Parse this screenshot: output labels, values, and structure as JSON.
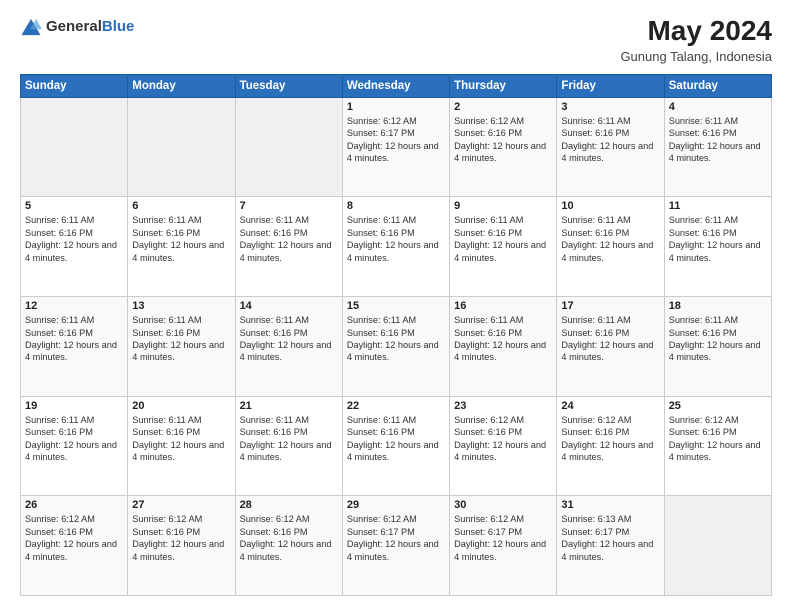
{
  "logo": {
    "general": "General",
    "blue": "Blue"
  },
  "header": {
    "title": "May 2024",
    "subtitle": "Gunung Talang, Indonesia"
  },
  "weekdays": [
    "Sunday",
    "Monday",
    "Tuesday",
    "Wednesday",
    "Thursday",
    "Friday",
    "Saturday"
  ],
  "weeks": [
    [
      {
        "day": "",
        "sunrise": "",
        "sunset": "",
        "daylight": "",
        "empty": true
      },
      {
        "day": "",
        "sunrise": "",
        "sunset": "",
        "daylight": "",
        "empty": true
      },
      {
        "day": "",
        "sunrise": "",
        "sunset": "",
        "daylight": "",
        "empty": true
      },
      {
        "day": "1",
        "sunrise": "Sunrise: 6:12 AM",
        "sunset": "Sunset: 6:17 PM",
        "daylight": "Daylight: 12 hours and 4 minutes."
      },
      {
        "day": "2",
        "sunrise": "Sunrise: 6:12 AM",
        "sunset": "Sunset: 6:16 PM",
        "daylight": "Daylight: 12 hours and 4 minutes."
      },
      {
        "day": "3",
        "sunrise": "Sunrise: 6:11 AM",
        "sunset": "Sunset: 6:16 PM",
        "daylight": "Daylight: 12 hours and 4 minutes."
      },
      {
        "day": "4",
        "sunrise": "Sunrise: 6:11 AM",
        "sunset": "Sunset: 6:16 PM",
        "daylight": "Daylight: 12 hours and 4 minutes."
      }
    ],
    [
      {
        "day": "5",
        "sunrise": "Sunrise: 6:11 AM",
        "sunset": "Sunset: 6:16 PM",
        "daylight": "Daylight: 12 hours and 4 minutes."
      },
      {
        "day": "6",
        "sunrise": "Sunrise: 6:11 AM",
        "sunset": "Sunset: 6:16 PM",
        "daylight": "Daylight: 12 hours and 4 minutes."
      },
      {
        "day": "7",
        "sunrise": "Sunrise: 6:11 AM",
        "sunset": "Sunset: 6:16 PM",
        "daylight": "Daylight: 12 hours and 4 minutes."
      },
      {
        "day": "8",
        "sunrise": "Sunrise: 6:11 AM",
        "sunset": "Sunset: 6:16 PM",
        "daylight": "Daylight: 12 hours and 4 minutes."
      },
      {
        "day": "9",
        "sunrise": "Sunrise: 6:11 AM",
        "sunset": "Sunset: 6:16 PM",
        "daylight": "Daylight: 12 hours and 4 minutes."
      },
      {
        "day": "10",
        "sunrise": "Sunrise: 6:11 AM",
        "sunset": "Sunset: 6:16 PM",
        "daylight": "Daylight: 12 hours and 4 minutes."
      },
      {
        "day": "11",
        "sunrise": "Sunrise: 6:11 AM",
        "sunset": "Sunset: 6:16 PM",
        "daylight": "Daylight: 12 hours and 4 minutes."
      }
    ],
    [
      {
        "day": "12",
        "sunrise": "Sunrise: 6:11 AM",
        "sunset": "Sunset: 6:16 PM",
        "daylight": "Daylight: 12 hours and 4 minutes."
      },
      {
        "day": "13",
        "sunrise": "Sunrise: 6:11 AM",
        "sunset": "Sunset: 6:16 PM",
        "daylight": "Daylight: 12 hours and 4 minutes."
      },
      {
        "day": "14",
        "sunrise": "Sunrise: 6:11 AM",
        "sunset": "Sunset: 6:16 PM",
        "daylight": "Daylight: 12 hours and 4 minutes."
      },
      {
        "day": "15",
        "sunrise": "Sunrise: 6:11 AM",
        "sunset": "Sunset: 6:16 PM",
        "daylight": "Daylight: 12 hours and 4 minutes."
      },
      {
        "day": "16",
        "sunrise": "Sunrise: 6:11 AM",
        "sunset": "Sunset: 6:16 PM",
        "daylight": "Daylight: 12 hours and 4 minutes."
      },
      {
        "day": "17",
        "sunrise": "Sunrise: 6:11 AM",
        "sunset": "Sunset: 6:16 PM",
        "daylight": "Daylight: 12 hours and 4 minutes."
      },
      {
        "day": "18",
        "sunrise": "Sunrise: 6:11 AM",
        "sunset": "Sunset: 6:16 PM",
        "daylight": "Daylight: 12 hours and 4 minutes."
      }
    ],
    [
      {
        "day": "19",
        "sunrise": "Sunrise: 6:11 AM",
        "sunset": "Sunset: 6:16 PM",
        "daylight": "Daylight: 12 hours and 4 minutes."
      },
      {
        "day": "20",
        "sunrise": "Sunrise: 6:11 AM",
        "sunset": "Sunset: 6:16 PM",
        "daylight": "Daylight: 12 hours and 4 minutes."
      },
      {
        "day": "21",
        "sunrise": "Sunrise: 6:11 AM",
        "sunset": "Sunset: 6:16 PM",
        "daylight": "Daylight: 12 hours and 4 minutes."
      },
      {
        "day": "22",
        "sunrise": "Sunrise: 6:11 AM",
        "sunset": "Sunset: 6:16 PM",
        "daylight": "Daylight: 12 hours and 4 minutes."
      },
      {
        "day": "23",
        "sunrise": "Sunrise: 6:12 AM",
        "sunset": "Sunset: 6:16 PM",
        "daylight": "Daylight: 12 hours and 4 minutes."
      },
      {
        "day": "24",
        "sunrise": "Sunrise: 6:12 AM",
        "sunset": "Sunset: 6:16 PM",
        "daylight": "Daylight: 12 hours and 4 minutes."
      },
      {
        "day": "25",
        "sunrise": "Sunrise: 6:12 AM",
        "sunset": "Sunset: 6:16 PM",
        "daylight": "Daylight: 12 hours and 4 minutes."
      }
    ],
    [
      {
        "day": "26",
        "sunrise": "Sunrise: 6:12 AM",
        "sunset": "Sunset: 6:16 PM",
        "daylight": "Daylight: 12 hours and 4 minutes."
      },
      {
        "day": "27",
        "sunrise": "Sunrise: 6:12 AM",
        "sunset": "Sunset: 6:16 PM",
        "daylight": "Daylight: 12 hours and 4 minutes."
      },
      {
        "day": "28",
        "sunrise": "Sunrise: 6:12 AM",
        "sunset": "Sunset: 6:16 PM",
        "daylight": "Daylight: 12 hours and 4 minutes."
      },
      {
        "day": "29",
        "sunrise": "Sunrise: 6:12 AM",
        "sunset": "Sunset: 6:17 PM",
        "daylight": "Daylight: 12 hours and 4 minutes."
      },
      {
        "day": "30",
        "sunrise": "Sunrise: 6:12 AM",
        "sunset": "Sunset: 6:17 PM",
        "daylight": "Daylight: 12 hours and 4 minutes."
      },
      {
        "day": "31",
        "sunrise": "Sunrise: 6:13 AM",
        "sunset": "Sunset: 6:17 PM",
        "daylight": "Daylight: 12 hours and 4 minutes."
      },
      {
        "day": "",
        "sunrise": "",
        "sunset": "",
        "daylight": "",
        "empty": true
      }
    ]
  ]
}
